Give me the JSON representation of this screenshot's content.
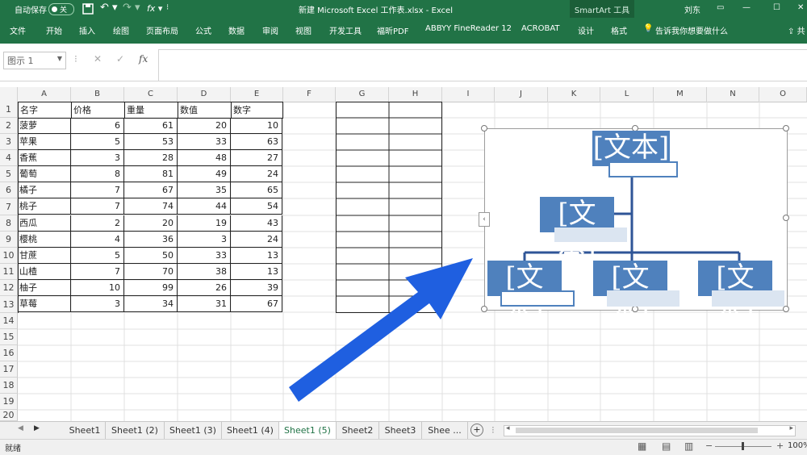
{
  "titlebar": {
    "autosave_label": "自动保存",
    "autosave_state": "关",
    "title": "新建 Microsoft Excel 工作表.xlsx  -  Excel",
    "context_group": "SmartArt 工具",
    "user": "刘东"
  },
  "ribbon": {
    "tabs": [
      "文件",
      "开始",
      "插入",
      "绘图",
      "页面布局",
      "公式",
      "数据",
      "审阅",
      "视图",
      "开发工具",
      "福昕PDF",
      "ABBYY FineReader 12",
      "ACROBAT",
      "设计",
      "格式"
    ],
    "tell_me": "告诉我你想要做什么",
    "share": "共"
  },
  "formula_bar": {
    "name_box": "图示 1",
    "fx": "fx",
    "value": ""
  },
  "grid": {
    "columns": [
      "A",
      "B",
      "C",
      "D",
      "E",
      "F",
      "G",
      "H",
      "I",
      "J",
      "K",
      "L",
      "M",
      "N",
      "O"
    ],
    "rows": [
      "1",
      "2",
      "3",
      "4",
      "5",
      "6",
      "7",
      "8",
      "9",
      "10",
      "11",
      "12",
      "13",
      "14",
      "15",
      "16",
      "17",
      "18",
      "19",
      "20"
    ],
    "headers": [
      "名字",
      "价格",
      "重量",
      "数值",
      "数字"
    ],
    "data": [
      [
        "菠萝",
        "6",
        "61",
        "20",
        "10"
      ],
      [
        "苹果",
        "5",
        "53",
        "33",
        "63"
      ],
      [
        "香蕉",
        "3",
        "28",
        "48",
        "27"
      ],
      [
        "葡萄",
        "8",
        "81",
        "49",
        "24"
      ],
      [
        "橘子",
        "7",
        "67",
        "35",
        "65"
      ],
      [
        "桃子",
        "7",
        "74",
        "44",
        "54"
      ],
      [
        "西瓜",
        "2",
        "20",
        "19",
        "43"
      ],
      [
        "樱桃",
        "4",
        "36",
        "3",
        "24"
      ],
      [
        "甘蔗",
        "5",
        "50",
        "33",
        "13"
      ],
      [
        "山楂",
        "7",
        "70",
        "38",
        "13"
      ],
      [
        "柚子",
        "10",
        "99",
        "26",
        "39"
      ],
      [
        "草莓",
        "3",
        "34",
        "31",
        "67"
      ]
    ]
  },
  "smartart": {
    "placeholder": "[文本]"
  },
  "sheets": {
    "tabs": [
      "Sheet1",
      "Sheet1 (2)",
      "Sheet1 (3)",
      "Sheet1 (4)",
      "Sheet1 (5)",
      "Sheet2",
      "Sheet3",
      "Shee ..."
    ],
    "active_index": 4
  },
  "statusbar": {
    "ready": "就绪",
    "zoom": "100%"
  },
  "colors": {
    "excel_green": "#217346",
    "smartart_blue": "#4f81bd",
    "arrow_blue": "#1f5fe0"
  }
}
